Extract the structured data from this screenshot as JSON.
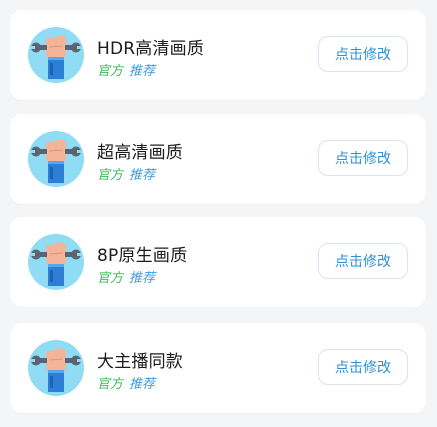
{
  "items": [
    {
      "title": "HDR高清画质",
      "tag_official": "官方",
      "tag_recommend": "推荐",
      "button_label": "点击修改",
      "icon": "wrench-hand-icon"
    },
    {
      "title": "超高清画质",
      "tag_official": "官方",
      "tag_recommend": "推荐",
      "button_label": "点击修改",
      "icon": "wrench-hand-icon"
    },
    {
      "title": "8P原生画质",
      "tag_official": "官方",
      "tag_recommend": "推荐",
      "button_label": "点击修改",
      "icon": "wrench-hand-icon"
    },
    {
      "title": "大主播同款",
      "tag_official": "官方",
      "tag_recommend": "推荐",
      "button_label": "点击修改",
      "icon": "wrench-hand-icon"
    }
  ],
  "colors": {
    "background": "#f4f5f7",
    "card": "#ffffff",
    "tag_official": "#3dbb5c",
    "tag_recommend": "#3f9adf",
    "button_text": "#2f8fd8",
    "avatar_bg": "#8fdcf4"
  }
}
